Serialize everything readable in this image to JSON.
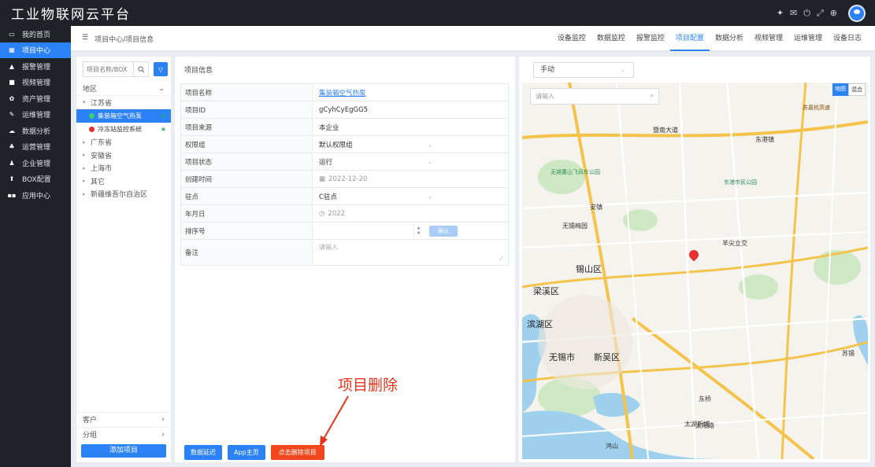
{
  "app": {
    "title": "工业物联网云平台"
  },
  "sidebar": {
    "items": [
      {
        "label": "我的首页",
        "icon": "monitor-icon"
      },
      {
        "label": "项目中心",
        "icon": "grid-icon",
        "active": true
      },
      {
        "label": "报警管理",
        "icon": "bell-icon"
      },
      {
        "label": "视频管理",
        "icon": "video-icon"
      },
      {
        "label": "资产管理",
        "icon": "gear-icon"
      },
      {
        "label": "运维管理",
        "icon": "wrench-icon"
      },
      {
        "label": "数据分析",
        "icon": "cloud-icon"
      },
      {
        "label": "运营管理",
        "icon": "people-icon"
      },
      {
        "label": "企业管理",
        "icon": "building-icon"
      },
      {
        "label": "BOX配置",
        "icon": "upload-icon"
      },
      {
        "label": "应用中心",
        "icon": "apps-icon"
      }
    ]
  },
  "header": {
    "breadcrumb": "项目中心/项目信息",
    "tabs": [
      "设备监控",
      "数据监控",
      "报警监控",
      "项目配置",
      "数据分析",
      "视频管理",
      "运维管理",
      "设备日志"
    ],
    "active_tab": "项目配置"
  },
  "tree": {
    "search_placeholder": "项目名称/BOX",
    "group_label": "地区",
    "nodes": [
      "江苏省",
      "广东省",
      "安徽省",
      "上海市",
      "其它",
      "新疆维吾尔自治区"
    ],
    "leaves": [
      {
        "label": "集装箱空气热泵",
        "status_color": "#3ad16a"
      },
      {
        "label": "冷冻站监控系统",
        "status_color": "#e62c2c"
      }
    ],
    "footer": [
      "客户",
      "分组"
    ],
    "add_button": "添加项目"
  },
  "form": {
    "title": "项目信息",
    "rows": [
      {
        "label": "项目名称",
        "value": "集装箱空气热泵"
      },
      {
        "label": "项目ID",
        "value": "gCyhCyEgGG5"
      },
      {
        "label": "项目来源",
        "value": "本企业"
      },
      {
        "label": "权限组",
        "value": "默认权限组"
      },
      {
        "label": "项目状态",
        "value": "运行"
      },
      {
        "label": "创建时间",
        "value": "2022-12-20"
      },
      {
        "label": "驻点",
        "value": "C驻点"
      },
      {
        "label": "年月日",
        "value": "2022"
      },
      {
        "label": "排序号",
        "value": ""
      },
      {
        "label": "备注",
        "value": ""
      }
    ],
    "confirm_label": "确认",
    "remark_placeholder": "请输入",
    "buttons": [
      "数据延迟",
      "App主页",
      "点击删除项目"
    ]
  },
  "annotation": {
    "text": "项目删除",
    "color": "#e8331c"
  },
  "map": {
    "mode": "手动",
    "search_placeholder": "请输入",
    "toggle": [
      "地图",
      "混合"
    ],
    "labels": [
      "暨南大道",
      "东港镇",
      "无锡惠山飞风车公园",
      "东港市民公园",
      "安镇",
      "无锡梅园",
      "羊尖立交",
      "锡山区",
      "梁溪区",
      "无锡市",
      "新吴区",
      "滨湖区",
      "太湖新城",
      "东桥",
      "太阳路",
      "鸿山",
      "苏嘉杭高速",
      "苏锡"
    ],
    "colors": {
      "water": "#9fd0ee",
      "land": "#f5f3ee",
      "green": "#cfe8c4",
      "road_major": "#f4c34a",
      "road_minor": "#ffffff"
    }
  }
}
